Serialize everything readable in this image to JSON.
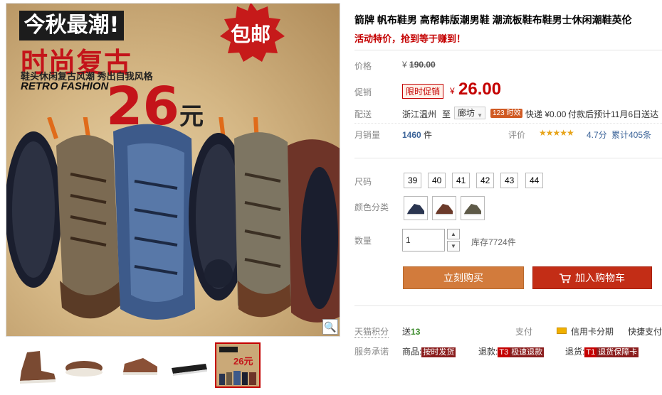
{
  "gallery": {
    "promo_top": "今秋最潮!",
    "promo_title": "时尚复古",
    "slogan": "鞋头休闲复古风潮 秀出自我风格",
    "retro_text": "RETRO FASHION",
    "big_price": "26",
    "big_price_unit": "元",
    "free_shipping": "包邮",
    "zoom_icon": "magnifier-icon",
    "thumb_promo_price": "26元"
  },
  "product": {
    "title": "箭牌 帆布鞋男 高帮韩版潮男鞋 潮流板鞋布鞋男士休闲潮鞋英伦",
    "promo_line": "活动特价，抢到等于赚到！"
  },
  "price": {
    "label": "价格",
    "currency": "¥",
    "original": "190.00",
    "promo_label": "促销",
    "promo_tag": "限时促销",
    "current": "26.00"
  },
  "shipping": {
    "label": "配送",
    "from": "浙江温州",
    "to_word": "至",
    "dest": "廊坊",
    "timely_badge": "123 时效",
    "express": "快递 ¥0.00",
    "eta": "付款后预计11月6日送达"
  },
  "sales": {
    "label": "月销量",
    "count": "1460",
    "unit": "件",
    "rating_label": "评价",
    "stars": "★★★★★",
    "score": "4.7分",
    "reviews": "累计405条"
  },
  "options": {
    "size_label": "尺码",
    "sizes": [
      "39",
      "40",
      "41",
      "42",
      "43",
      "44"
    ],
    "color_label": "颜色分类",
    "colors": [
      "#2a3550",
      "#6b3a2a",
      "#5e5a48"
    ]
  },
  "quantity": {
    "label": "数量",
    "value": "1",
    "stock": "库存7724件"
  },
  "actions": {
    "buy_now": "立刻购买",
    "add_cart": "加入购物车"
  },
  "footer": {
    "tmall_points_label": "天猫积分",
    "send_word": "送",
    "points": "13",
    "pay_label": "支付",
    "credit": "信用卡分期",
    "quick_pay": "快捷支付",
    "service_label": "服务承诺",
    "goods_label": "商品:",
    "goods_tag": "按时发货",
    "refund_label": "退款:",
    "refund_code": "T3",
    "refund_tag": "极速退款",
    "return_label": "退货:",
    "return_code": "T1",
    "return_tag": "退货保障卡"
  },
  "colors": {
    "accent_red": "#c40000",
    "buy_orange": "#d27b3c",
    "cart_red": "#c32d16",
    "link_blue": "#3c6499"
  }
}
